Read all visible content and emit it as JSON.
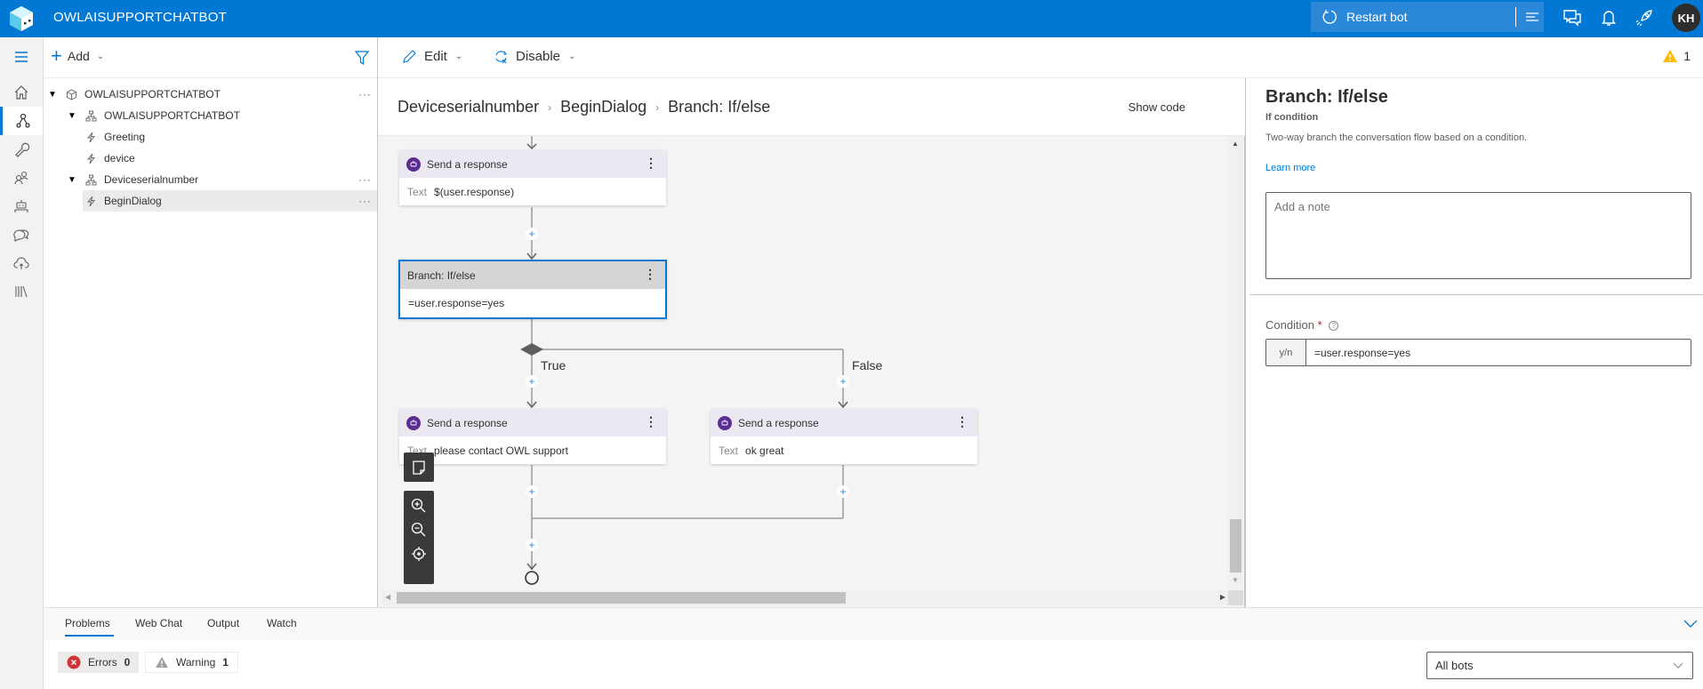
{
  "header": {
    "app_title": "OWLAISUPPORTCHATBOT",
    "restart_label": "Restart bot",
    "avatar_initials": "KH",
    "accent_color": "#0078d4"
  },
  "rail": {
    "items": [
      {
        "name": "home",
        "icon": "home-icon"
      },
      {
        "name": "design",
        "icon": "flow-icon",
        "active": true
      },
      {
        "name": "configure",
        "icon": "wrench-icon"
      },
      {
        "name": "users",
        "icon": "users-icon"
      },
      {
        "name": "bot-responses",
        "icon": "robot-icon"
      },
      {
        "name": "knowledge",
        "icon": "chat-icon"
      },
      {
        "name": "publish",
        "icon": "cloud-upload-icon"
      },
      {
        "name": "library",
        "icon": "library-icon"
      }
    ]
  },
  "tree": {
    "add_label": "Add",
    "items": [
      {
        "label": "OWLAISUPPORTCHATBOT",
        "level": 0,
        "type": "bot",
        "expanded": true,
        "more": true
      },
      {
        "label": "OWLAISUPPORTCHATBOT",
        "level": 1,
        "type": "dialog",
        "expanded": true,
        "more": false
      },
      {
        "label": "Greeting",
        "level": 2,
        "type": "trigger",
        "more": false
      },
      {
        "label": "device",
        "level": 2,
        "type": "trigger",
        "more": false
      },
      {
        "label": "Deviceserialnumber",
        "level": 1,
        "type": "dialog",
        "expanded": true,
        "more": true
      },
      {
        "label": "BeginDialog",
        "level": 2,
        "type": "trigger",
        "selected": true,
        "more": true
      }
    ]
  },
  "toolbar": {
    "edit_label": "Edit",
    "disable_label": "Disable",
    "warning_count": "1"
  },
  "breadcrumb": {
    "items": [
      "Deviceserialnumber",
      "BeginDialog",
      "Branch: If/else"
    ],
    "show_code_label": "Show code"
  },
  "canvas": {
    "nodes": {
      "send1": {
        "title": "Send a response",
        "key": "Text",
        "value": "$(user.response)"
      },
      "branch": {
        "title": "Branch: If/else",
        "value": "=user.response=yes"
      },
      "send_true": {
        "title": "Send a response",
        "key": "Text",
        "value": "please contact OWL support"
      },
      "send_false": {
        "title": "Send a response",
        "key": "Text",
        "value": "ok great"
      }
    },
    "true_label": "True",
    "false_label": "False"
  },
  "properties": {
    "title": "Branch: If/else",
    "subtitle": "If condition",
    "description": "Two-way branch the conversation flow based on a condition.",
    "learn_more": "Learn more",
    "note_placeholder": "Add a note",
    "condition_label": "Condition",
    "condition_required": "*",
    "condition_prefix": "y/n",
    "condition_value": "=user.response=yes"
  },
  "bottom": {
    "tabs": [
      "Problems",
      "Web Chat",
      "Output",
      "Watch"
    ],
    "active_tab": "Problems",
    "errors_label": "Errors",
    "errors_count": "0",
    "warning_label": "Warning",
    "warning_count": "1",
    "bot_filter": "All bots"
  }
}
